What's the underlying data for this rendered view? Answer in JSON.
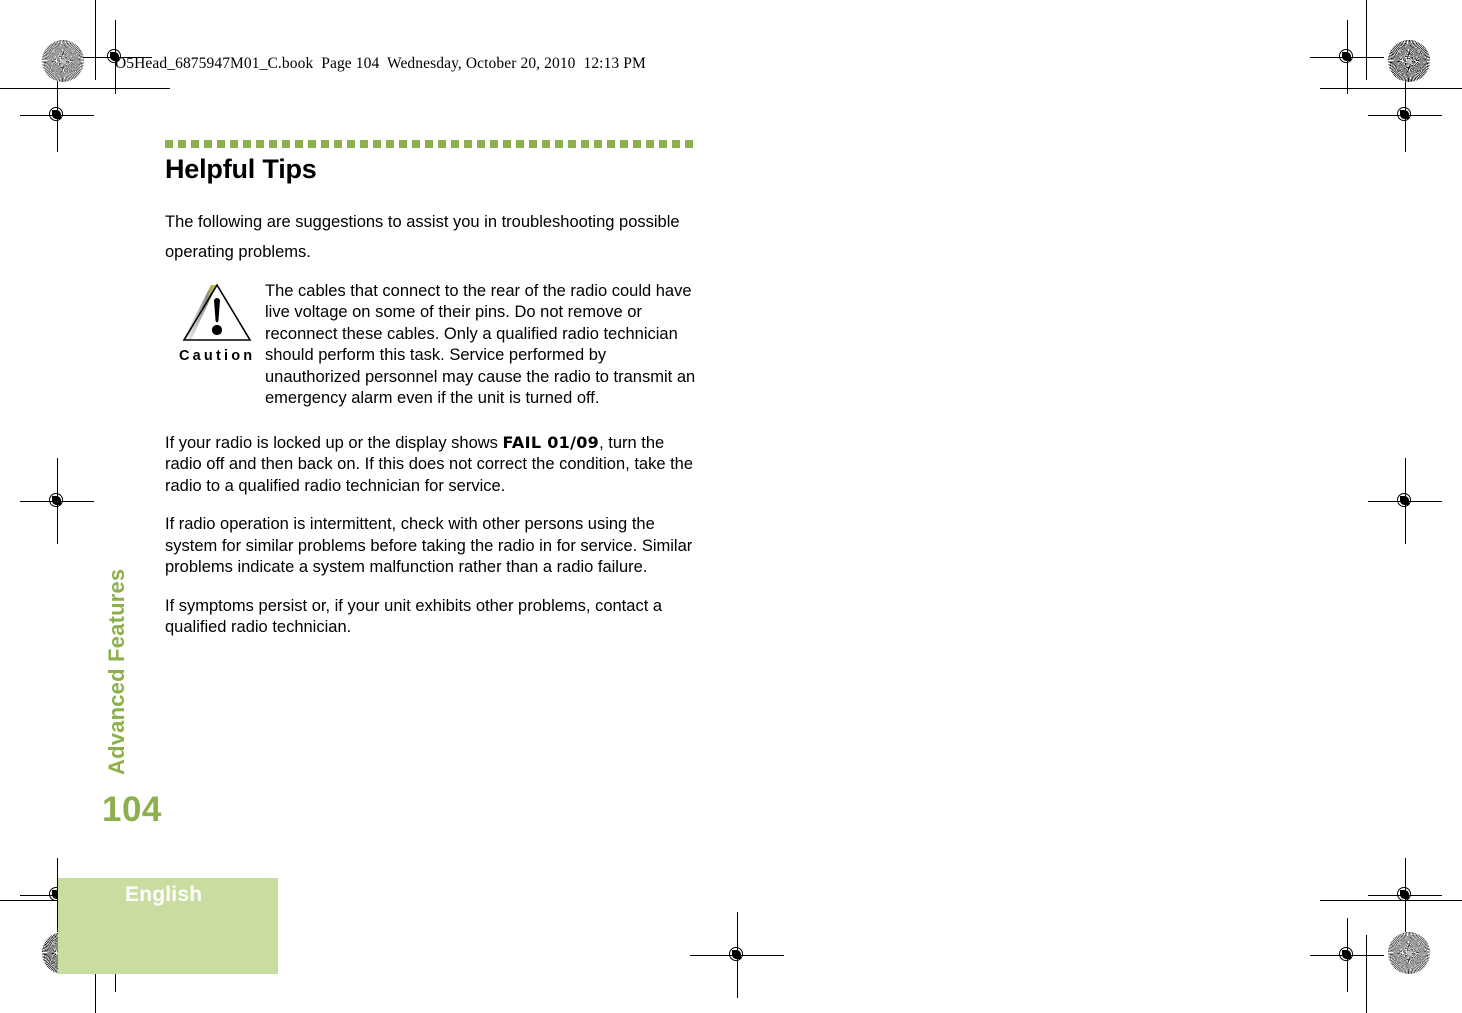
{
  "header": {
    "slug": "O5Head_6875947M01_C.book  Page 104  Wednesday, October 20, 2010  12:13 PM"
  },
  "colors": {
    "accent_green": "#8cb04b",
    "band_green": "#c9dda0",
    "text_black": "#000000"
  },
  "section": {
    "title": "Helpful Tips",
    "intro": "The following are suggestions to assist you in troubleshooting possible operating problems."
  },
  "caution": {
    "label": "Caution",
    "icon": "warning-triangle-icon",
    "text": "The cables that connect to the rear of the radio could have live voltage on some of their pins. Do not remove or reconnect these cables. Only a qualified radio technician should perform this task. Service performed by unauthorized personnel may cause the radio to transmit an emergency alarm even if the unit is turned off."
  },
  "paragraphs": [
    {
      "before": "If your radio is locked up or the display shows ",
      "display_code": "FAIL 01/09",
      "after": ", turn the radio off and then back on. If this does not correct the condition, take the radio to a qualified radio technician for service."
    },
    {
      "before": "If radio operation is intermittent, check with other persons using the system for similar problems before taking the radio in for service. Similar problems indicate a system malfunction rather than a radio failure.",
      "display_code": "",
      "after": ""
    },
    {
      "before": "If symptoms persist or, if your unit exhibits other problems, contact a qualified radio technician.",
      "display_code": "",
      "after": ""
    }
  ],
  "chapter_tab": {
    "label": "Advanced Features"
  },
  "footer": {
    "page_number": "104",
    "language": "English"
  }
}
